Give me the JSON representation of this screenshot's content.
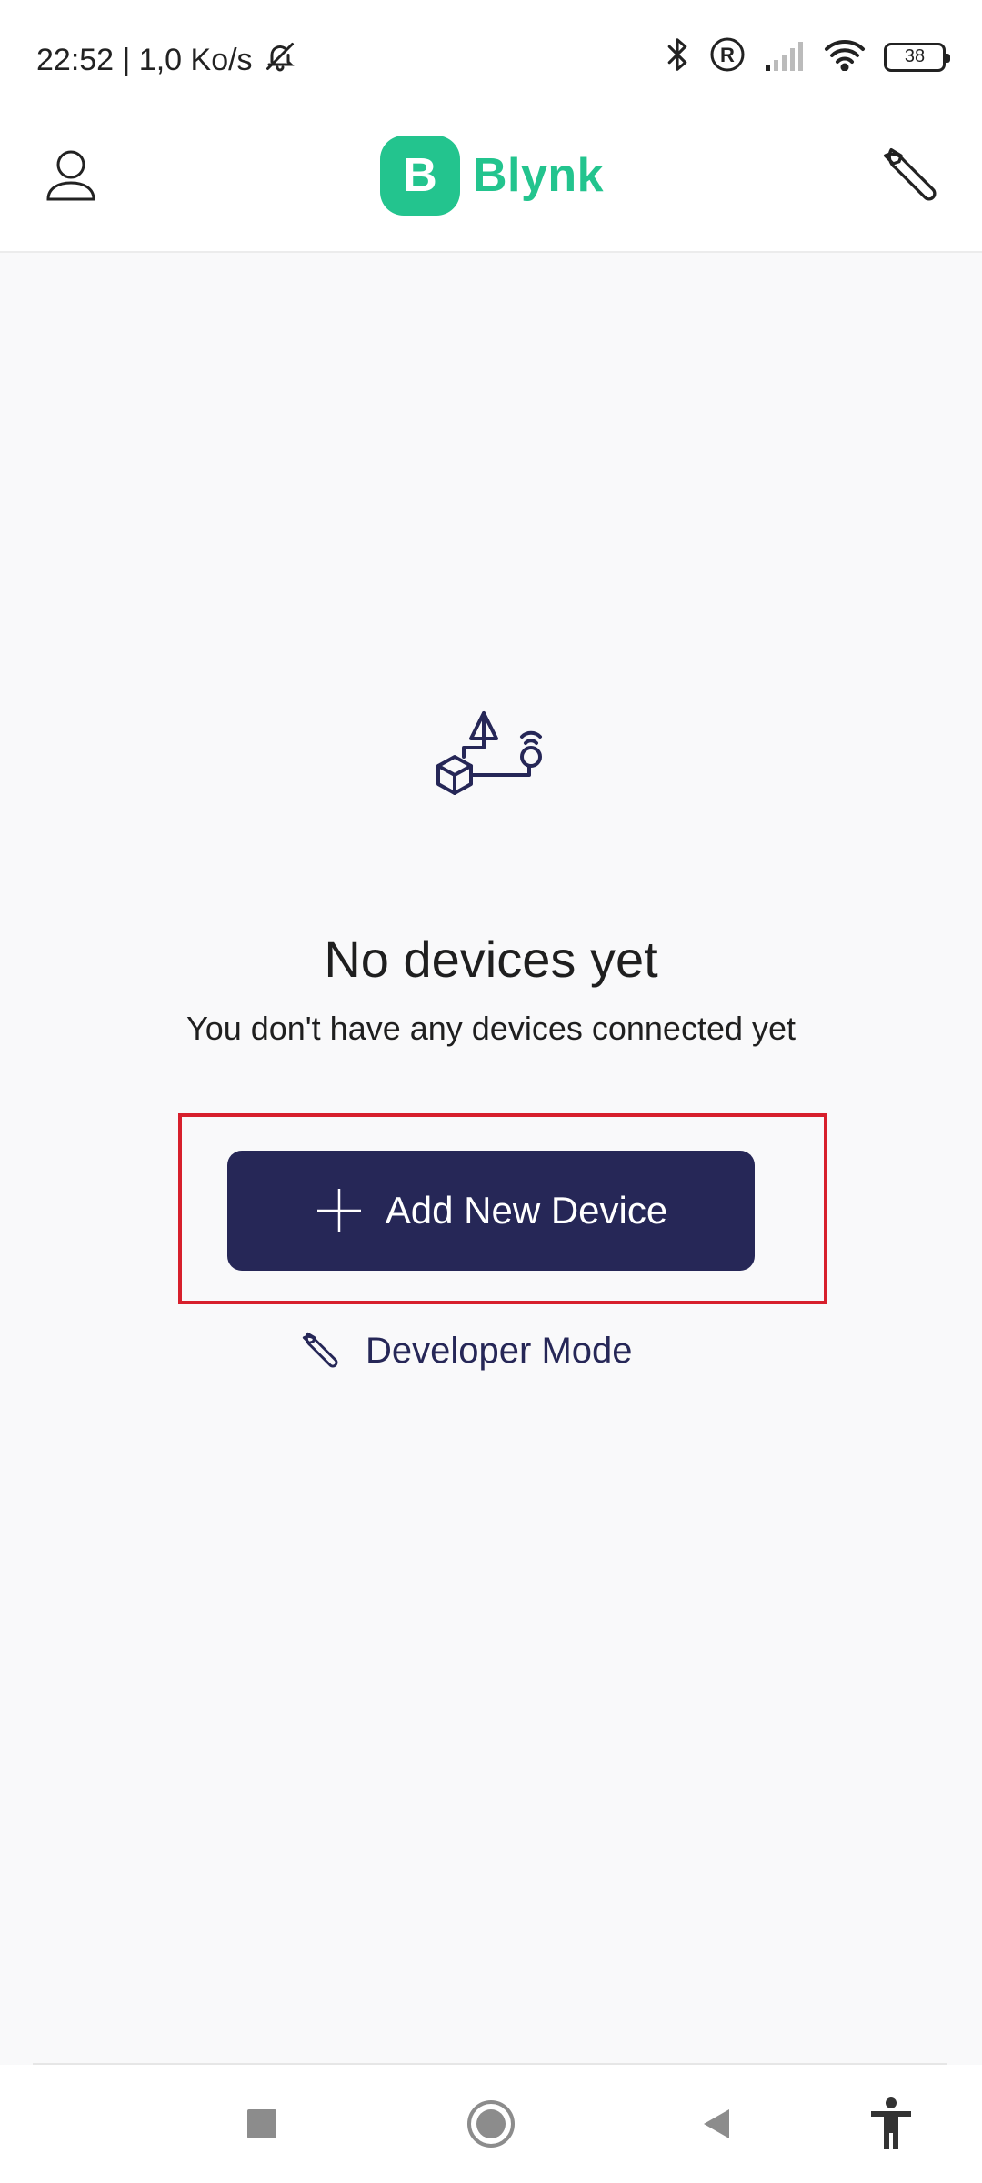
{
  "status_bar": {
    "time_net": "22:52 | 1,0 Ko/s",
    "battery": "38"
  },
  "app_bar": {
    "logo_letter": "B",
    "logo_text": "Blynk"
  },
  "empty_state": {
    "title": "No devices yet",
    "subtitle": "You don't have any devices connected yet",
    "add_button_label": "Add New Device",
    "developer_mode_label": "Developer Mode"
  },
  "colors": {
    "brand": "#23c48e",
    "primary_button": "#262757",
    "highlight": "#d71f2c"
  },
  "icons": [
    "mute-bell-icon",
    "bluetooth-icon",
    "roaming-icon",
    "signal-icon",
    "wifi-icon",
    "battery-icon",
    "profile-icon",
    "wrench-icon",
    "devices-illustration-icon",
    "plus-icon",
    "nav-square-icon",
    "nav-home-icon",
    "nav-back-icon",
    "accessibility-icon"
  ]
}
